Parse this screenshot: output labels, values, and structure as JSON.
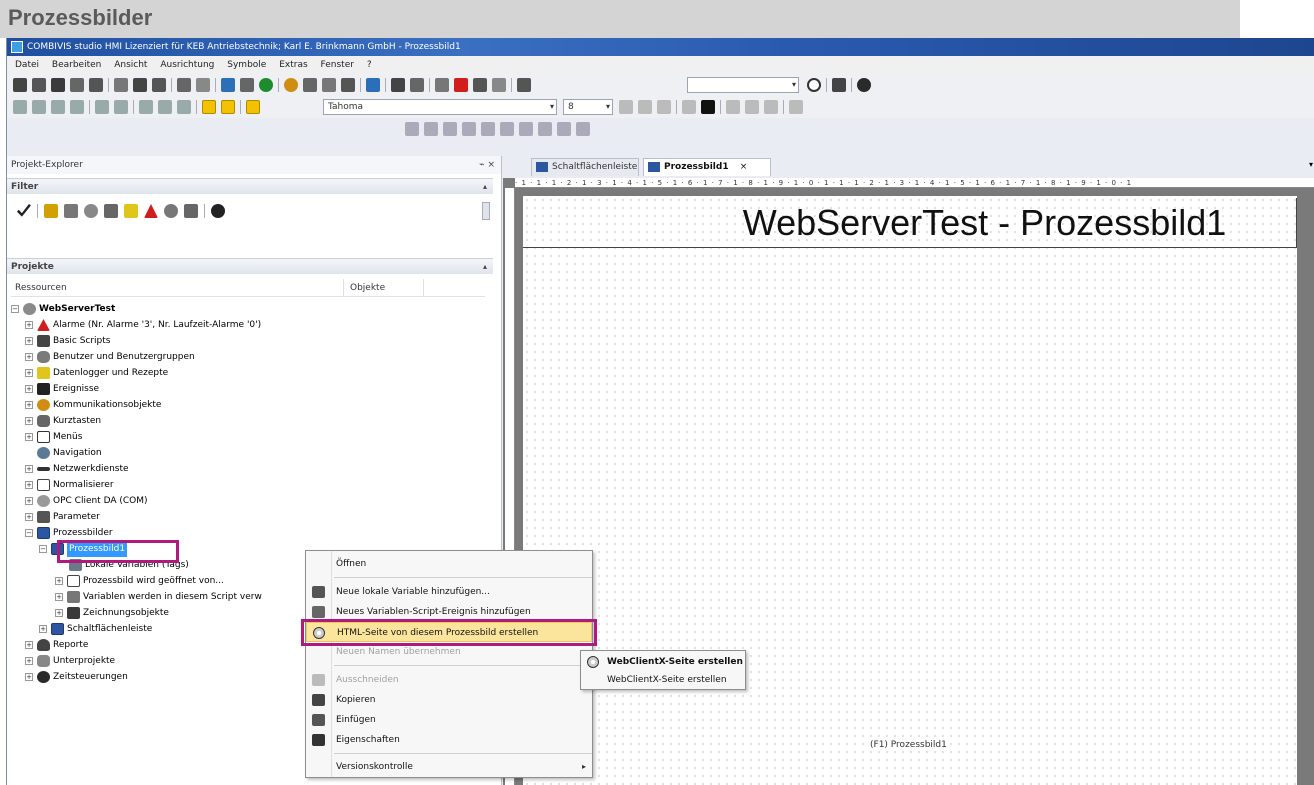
{
  "page_header": {
    "title": "Prozessbilder"
  },
  "window": {
    "title": "COMBIVIS studio HMI Lizenziert für KEB Antriebstechnik; Karl E. Brinkmann GmbH - Prozessbild1"
  },
  "menubar": {
    "items": [
      "Datei",
      "Bearbeiten",
      "Ansicht",
      "Ausrichtung",
      "Symbole",
      "Extras",
      "Fenster",
      "?"
    ]
  },
  "toolbar": {
    "font_name": "Tahoma",
    "font_size": "8"
  },
  "explorer": {
    "title": "Projekt-Explorer",
    "pin": "⌁ ×",
    "filter_section": "Filter",
    "projects_section": "Projekte",
    "col_resources": "Ressourcen",
    "col_objects": "Objekte",
    "tree": {
      "root": "WebServerTest",
      "items": [
        "Alarme (Nr. Alarme '3', Nr. Laufzeit-Alarme '0')",
        "Basic Scripts",
        "Benutzer und Benutzergruppen",
        "Datenlogger und Rezepte",
        "Ereignisse",
        "Kommunikationsobjekte",
        "Kurztasten",
        "Menüs",
        "Navigation",
        "Netzwerkdienste",
        "Normalisierer",
        "OPC Client DA (COM)",
        "Parameter",
        "Prozessbilder"
      ],
      "prozessbild1": "Prozessbild1",
      "children": [
        "Lokale Variablen (Tags)",
        "Prozessbild wird geöffnet von...",
        "Variablen werden in diesem Script verw",
        "Zeichnungsobjekte"
      ],
      "after": [
        "Schaltflächenleiste",
        "Reporte",
        "Unterprojekte",
        "Zeitsteuerungen"
      ]
    }
  },
  "editor": {
    "tabs": [
      {
        "label": "Schaltflächenleiste"
      },
      {
        "label": "Prozessbild1",
        "close": "×"
      }
    ],
    "ruler": "· 1 · 1 · 1 · 2 · 1 · 3 · 1 · 4 · 1 · 5 · 1 · 6 · 1 · 7 · 1 · 8 · 1 · 9 · 1 · 0 · 1 · 1 · 1 · 2 · 1 · 3 · 1 · 4 · 1 · 5 · 1 · 6 · 1 · 7 · 1 · 8 · 1 · 9 · 1 · 0 · 1",
    "canvas_title": "WebServerTest - Prozessbild1",
    "canvas_caption": "(F1) Prozessbild1"
  },
  "context_menu": {
    "items": {
      "open": "Öffnen",
      "add_local_var": "Neue lokale Variable hinzufügen...",
      "add_script_event": "Neues Variablen-Script-Ereignis hinzufügen",
      "create_html": "HTML-Seite von diesem Prozessbild erstellen",
      "adopt_name": "Neuen Namen übernehmen",
      "cut": "Ausschneiden",
      "copy": "Kopieren",
      "paste": "Einfügen",
      "properties": "Eigenschaften",
      "version_control": "Versionskontrolle"
    }
  },
  "submenu": {
    "items": [
      "WebClientX-Seite erstellen",
      "WebClientX-Seite erstellen"
    ]
  },
  "colors": {
    "highlight_box": "#b0197d",
    "selection": "#3399ff",
    "menu_hover": "#fbe59c"
  }
}
